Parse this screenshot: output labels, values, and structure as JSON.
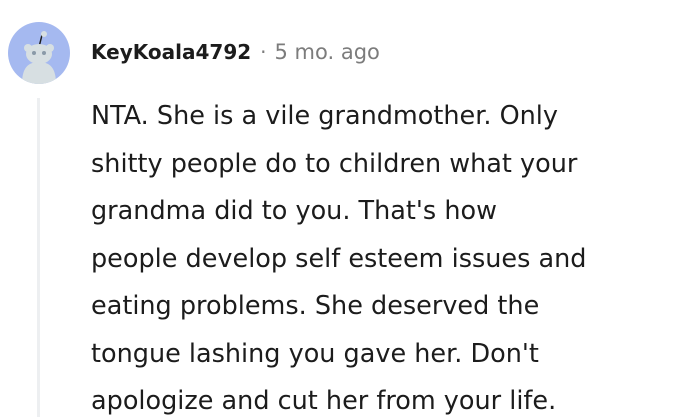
{
  "comment": {
    "username": "KeyKoala4792",
    "separator": "·",
    "timestamp": "5 mo. ago",
    "avatar_icon": "reddit-snoo-avatar-icon",
    "body_lines": [
      "NTA. She is a vile grandmother. Only",
      "shitty people do to children what your",
      "grandma did to you. That's how",
      "people develop self esteem issues and",
      "eating problems. She deserved the",
      "tongue lashing you gave her. Don't",
      "apologize and cut her from your life."
    ]
  },
  "colors": {
    "avatar_background": "#a5b9f0",
    "text": "#1c1c1c",
    "meta_text": "#7c7c7c",
    "thread_line": "#edeff1"
  }
}
